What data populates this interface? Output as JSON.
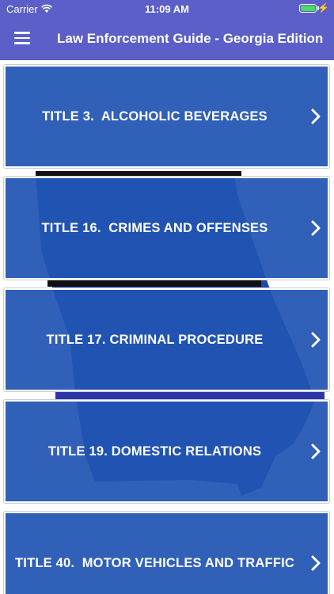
{
  "status_bar": {
    "carrier": "Carrier",
    "time": "11:09 AM",
    "icons": [
      "wifi-icon",
      "battery-icon",
      "charging-bolt-icon"
    ]
  },
  "navbar": {
    "title": "Law Enforcement Guide - Georgia Edition",
    "menu_icon": "hamburger-menu-icon"
  },
  "colors": {
    "bar": "#5b5fc7",
    "card": "#2154b4",
    "card_border": "#ffffff"
  },
  "titles": [
    {
      "label": "TITLE 3.  ALCOHOLIC BEVERAGES"
    },
    {
      "label": "TITLE 16.  CRIMES AND OFFENSES"
    },
    {
      "label": "TITLE 17. CRIMINAL PROCEDURE"
    },
    {
      "label": "TITLE 19. DOMESTIC RELATIONS"
    },
    {
      "label": "TITLE 40.  MOTOR VEHICLES AND TRAFFIC"
    }
  ]
}
